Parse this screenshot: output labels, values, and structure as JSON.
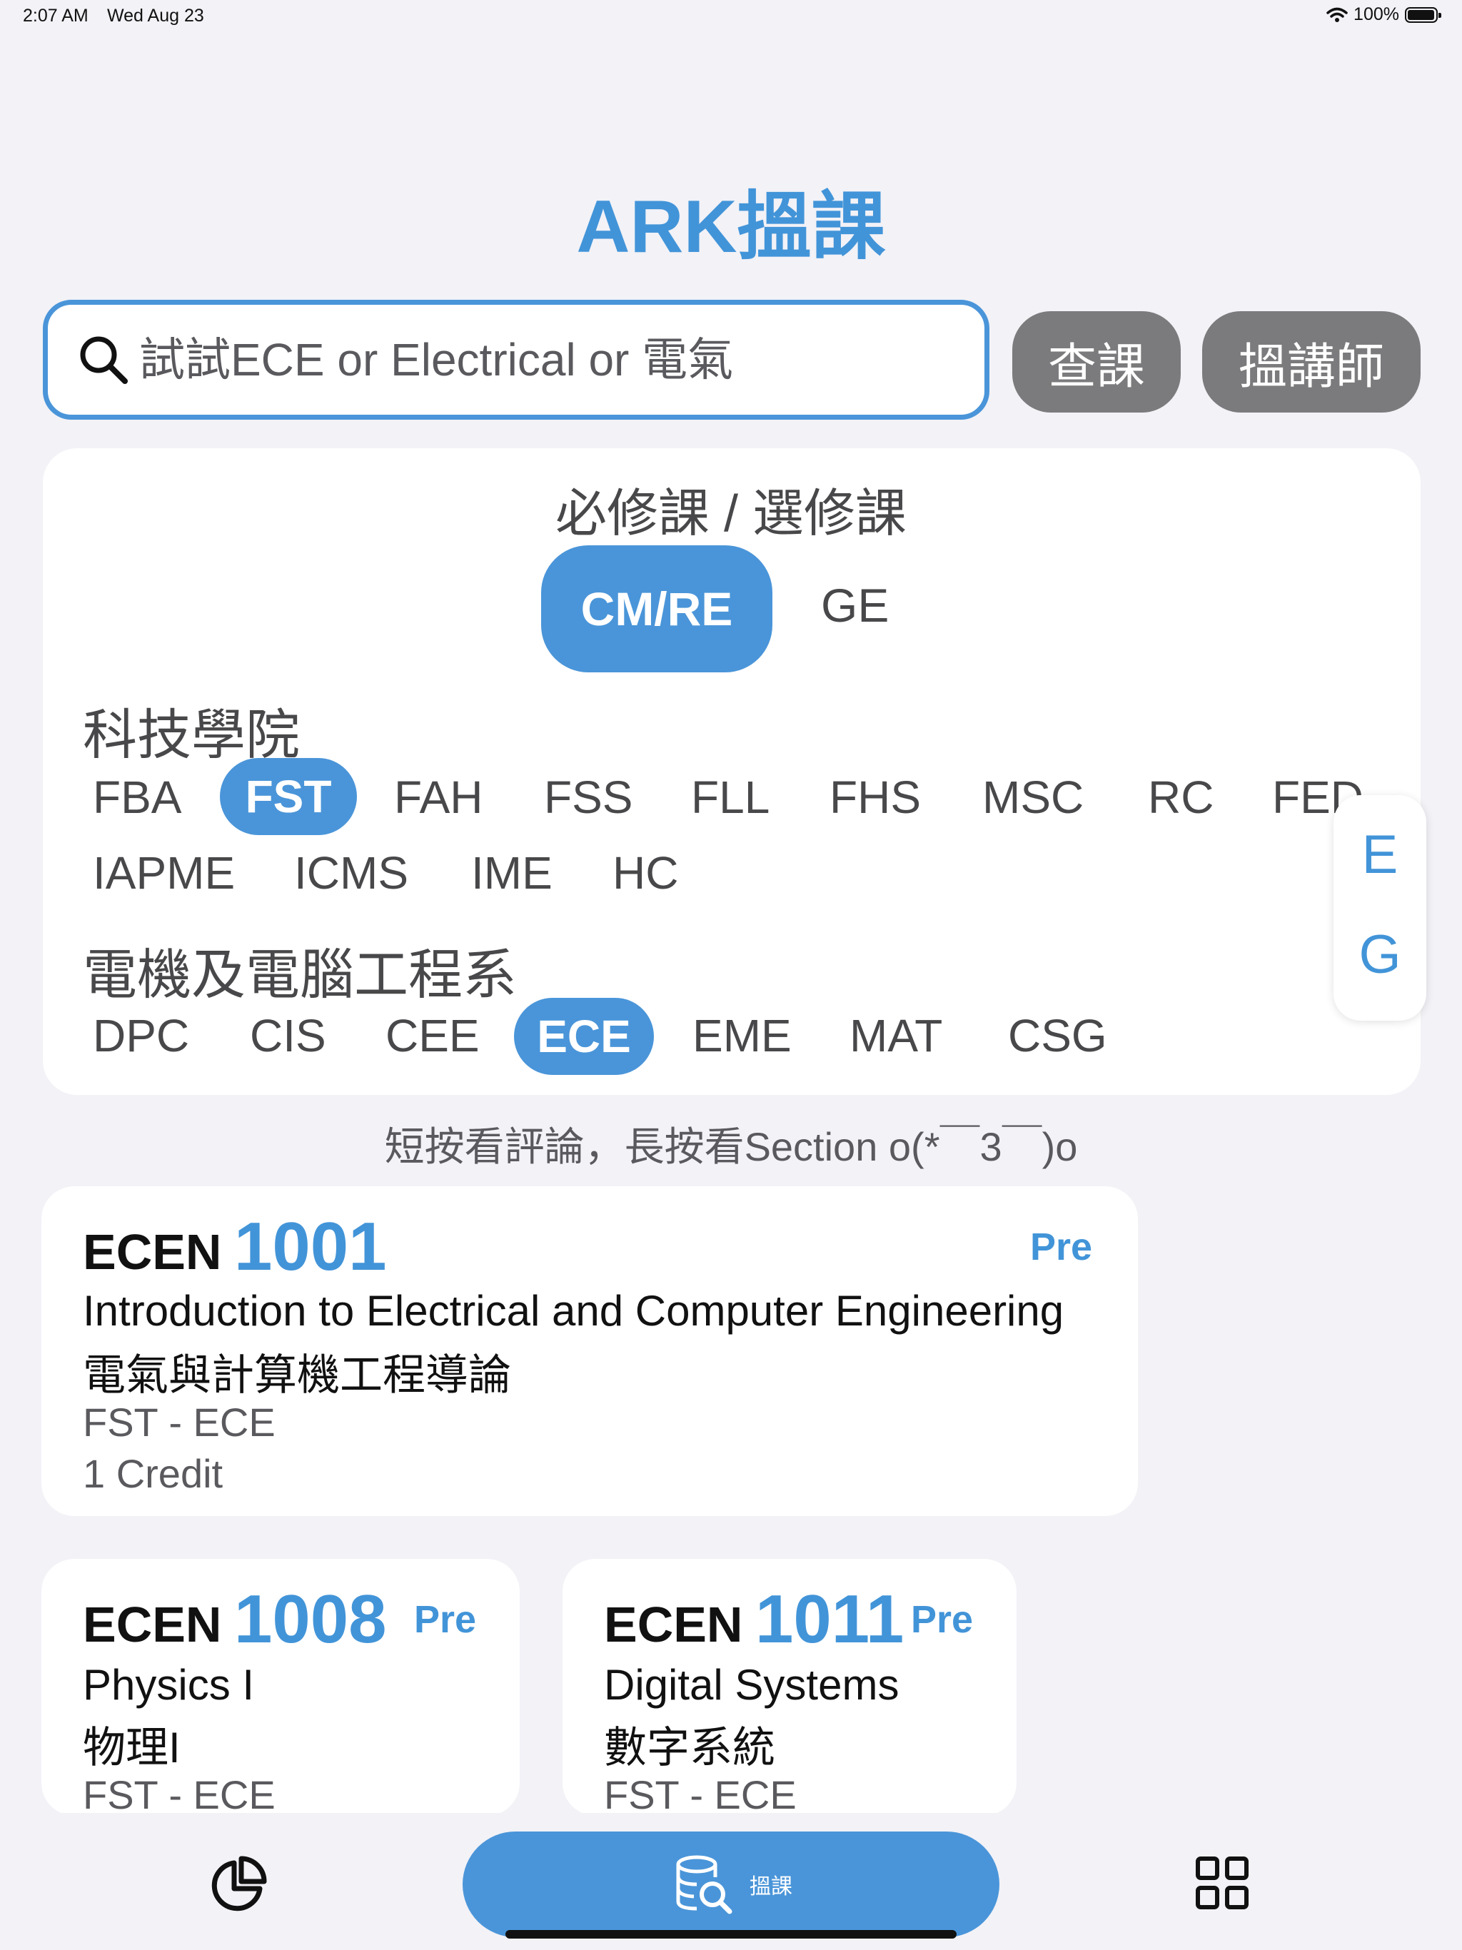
{
  "status_bar": {
    "time": "2:07 AM",
    "date": "Wed Aug 23",
    "battery": "100%",
    "battery_level": 1.0
  },
  "app": {
    "title": "ARK搵課"
  },
  "search": {
    "placeholder": "試試ECE or Electrical or 電氣",
    "value": ""
  },
  "buttons": {
    "query": "查課",
    "teacher": "搵講師"
  },
  "filter": {
    "section_title": "必修課 / 選修課",
    "course_types": [
      {
        "label": "CM/RE",
        "selected": true
      },
      {
        "label": "GE",
        "selected": false
      }
    ],
    "faculty_title": "科技學院",
    "faculties": [
      "FBA",
      "FST",
      "FAH",
      "FSS",
      "FLL",
      "FHS",
      "MSC",
      "RC",
      "FED",
      "IAPME",
      "ICMS",
      "IME",
      "HC"
    ],
    "selected_faculty": "FST",
    "department_title": "電機及電腦工程系",
    "departments": [
      "DPC",
      "CIS",
      "CEE",
      "ECE",
      "EME",
      "MAT",
      "CSG"
    ],
    "selected_department": "ECE"
  },
  "side_index": [
    "E",
    "G"
  ],
  "hint": "短按看評論，長按看Section o(*￣3￣)o",
  "courses": [
    {
      "prefix": "ECEN",
      "code": "1001",
      "badge": "Pre",
      "name_en": "Introduction to Electrical and Computer Engineering",
      "name_zh": "電氣與計算機工程導論",
      "unit": "FST - ECE",
      "credit": "1 Credit"
    },
    {
      "prefix": "ECEN",
      "code": "1008",
      "badge": "Pre",
      "name_en": "Physics I",
      "name_zh": "物理I",
      "unit": "FST - ECE"
    },
    {
      "prefix": "ECEN",
      "code": "1011",
      "badge": "Pre",
      "name_en": "Digital Systems",
      "name_zh": "數字系統",
      "unit": "FST - ECE"
    }
  ],
  "bottom_nav": {
    "center_label": "搵課",
    "icons": [
      "pie-chart-icon",
      "database-search-icon",
      "grid-icon"
    ]
  },
  "colors": {
    "accent": "#4a95d9",
    "button_gray": "#7b7b7d",
    "background": "#f2f2f7"
  }
}
